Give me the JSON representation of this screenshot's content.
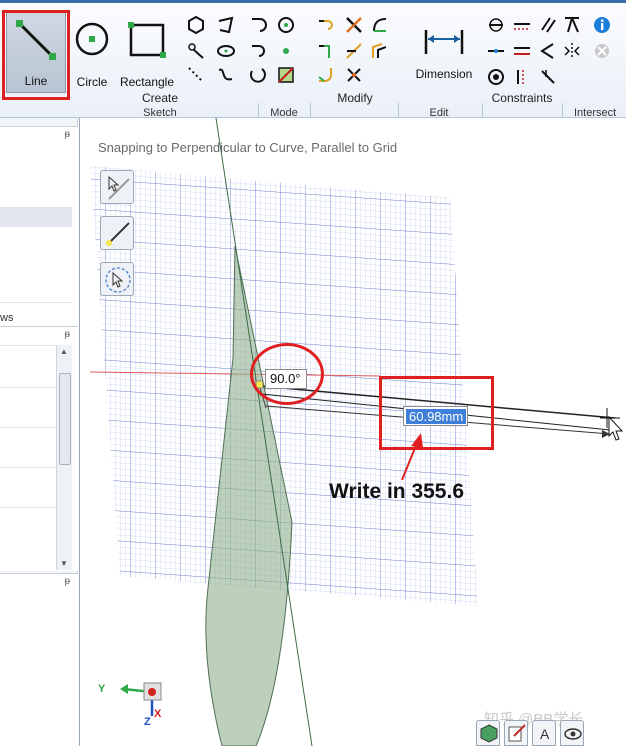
{
  "ribbon": {
    "sketch_tools": {
      "line_label": "Line",
      "circle_label": "Circle",
      "rectangle_label": "Rectangle"
    },
    "dimension_label": "Dimension",
    "groups": {
      "create": "Create",
      "modify": "Modify",
      "constraints": "Constraints"
    },
    "lower_tabs": {
      "sketch": "Sketch",
      "mode": "Mode",
      "edit": "Edit",
      "intersect": "Intersect"
    }
  },
  "left_panel": {
    "fragment_label": "ws",
    "pin_glyph": "ᵽ"
  },
  "viewport": {
    "status_text": "Snapping to Perpendicular to Curve, Parallel to Grid",
    "angle_value": "90.0°",
    "dimension_value": "60.98mm",
    "annotation": "Write in 355.6",
    "watermark": "知乎 @BB学长",
    "triad": {
      "y": "Y",
      "z": "Z",
      "x": "X"
    }
  },
  "colors": {
    "highlight_red": "#e02020",
    "selection_blue": "#3d7fd9",
    "grid_blue": "#5b6fd0",
    "plane_green": "#8fb090",
    "ribbon_blue": "#3b6ea8"
  }
}
